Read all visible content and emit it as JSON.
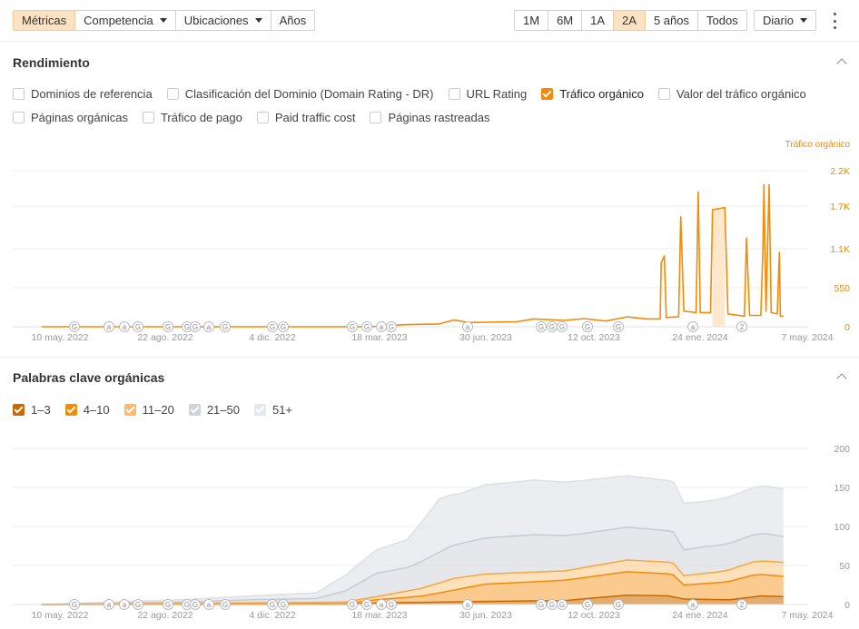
{
  "toolbar": {
    "left": [
      {
        "label": "Métricas",
        "active": true,
        "dropdown": false
      },
      {
        "label": "Competencia",
        "active": false,
        "dropdown": true
      },
      {
        "label": "Ubicaciones",
        "active": false,
        "dropdown": true
      },
      {
        "label": "Años",
        "active": false,
        "dropdown": false
      }
    ],
    "ranges": [
      {
        "label": "1M",
        "active": false
      },
      {
        "label": "6M",
        "active": false
      },
      {
        "label": "1A",
        "active": false
      },
      {
        "label": "2A",
        "active": true
      },
      {
        "label": "5 años",
        "active": false
      },
      {
        "label": "Todos",
        "active": false
      }
    ],
    "interval": "Diario"
  },
  "performance": {
    "title": "Rendimiento",
    "metrics_row1": [
      {
        "label": "Dominios de referencia",
        "checked": false
      },
      {
        "label": "Clasificación del Dominio (Domain Rating - DR)",
        "checked": false
      },
      {
        "label": "URL Rating",
        "checked": false
      },
      {
        "label": "Tráfico orgánico",
        "checked": true
      },
      {
        "label": "Valor del tráfico orgánico",
        "checked": false
      }
    ],
    "metrics_row2": [
      {
        "label": "Páginas orgánicas",
        "checked": false
      },
      {
        "label": "Tráfico de pago",
        "checked": false
      },
      {
        "label": "Paid traffic cost",
        "checked": false
      },
      {
        "label": "Páginas rastreadas",
        "checked": false
      }
    ]
  },
  "keywords": {
    "title": "Palabras clave orgánicas",
    "legend": [
      {
        "label": "1–3",
        "color": "#c96a00"
      },
      {
        "label": "4–10",
        "color": "#f58a07"
      },
      {
        "label": "11–20",
        "color": "#fbbb6a"
      },
      {
        "label": "21–50",
        "color": "#d0d4da"
      },
      {
        "label": "51+",
        "color": "#e4e7eb"
      }
    ]
  },
  "x_axis_ticks": [
    "10 may. 2022",
    "22 ago. 2022",
    "4 dic. 2022",
    "18 mar. 2023",
    "30 jun. 2023",
    "12 oct. 2023",
    "24 ene. 2024",
    "7 may. 2024"
  ],
  "markers": [
    "G",
    "a",
    "2"
  ],
  "colors": {
    "accent": "#f58a07",
    "accent_light": "#fde2c2",
    "grid": "#eeeeee"
  },
  "chart_data": [
    {
      "type": "line",
      "title": "",
      "series": [
        {
          "name": "Tráfico orgánico",
          "color": "#f58a07",
          "points": [
            [
              "2022-05-10",
              0
            ],
            [
              "2023-03-25",
              0
            ],
            [
              "2023-04-28",
              30
            ],
            [
              "2023-06-01",
              40
            ],
            [
              "2023-06-15",
              95
            ],
            [
              "2023-06-30",
              60
            ],
            [
              "2023-08-15",
              70
            ],
            [
              "2023-09-01",
              110
            ],
            [
              "2023-10-01",
              90
            ],
            [
              "2023-10-20",
              115
            ],
            [
              "2023-11-10",
              80
            ],
            [
              "2023-12-01",
              140
            ],
            [
              "2023-12-20",
              110
            ],
            [
              "2024-01-02",
              110
            ],
            [
              "2024-01-03",
              900
            ],
            [
              "2024-01-06",
              1000
            ],
            [
              "2024-01-08",
              130
            ],
            [
              "2024-01-20",
              140
            ],
            [
              "2024-01-22",
              1550
            ],
            [
              "2024-01-25",
              220
            ],
            [
              "2024-02-06",
              200
            ],
            [
              "2024-02-08",
              1900
            ],
            [
              "2024-02-10",
              200
            ],
            [
              "2024-02-20",
              200
            ],
            [
              "2024-02-22",
              1650
            ],
            [
              "2024-03-05",
              1680
            ],
            [
              "2024-03-08",
              180
            ],
            [
              "2024-03-24",
              150
            ],
            [
              "2024-03-26",
              1250
            ],
            [
              "2024-03-29",
              160
            ],
            [
              "2024-04-09",
              160
            ],
            [
              "2024-04-11",
              1100
            ],
            [
              "2024-04-12",
              2000
            ],
            [
              "2024-04-14",
              220
            ],
            [
              "2024-04-17",
              2000
            ],
            [
              "2024-04-19",
              200
            ],
            [
              "2024-04-25",
              180
            ],
            [
              "2024-04-27",
              1050
            ],
            [
              "2024-04-28",
              150
            ],
            [
              "2024-05-01",
              150
            ]
          ]
        }
      ],
      "ylabel": "Tráfico orgánico",
      "x_range": [
        "2022-04-12",
        "2024-05-25"
      ],
      "ylim": [
        0,
        2200
      ],
      "y_ticks": [
        0,
        550,
        1100,
        1700,
        2200
      ],
      "y_tick_labels": [
        "0",
        "550",
        "1.1K",
        "1.7K",
        "2.2K"
      ],
      "grid": true
    },
    {
      "type": "area",
      "title": "",
      "stacked": true,
      "x_range": [
        "2022-04-12",
        "2024-05-25"
      ],
      "ylim": [
        0,
        200
      ],
      "y_ticks": [
        0,
        50,
        100,
        150,
        200
      ],
      "grid": true,
      "series": [
        {
          "name": "1–3",
          "color": "#c96a00",
          "points": [
            [
              "2022-05-10",
              0
            ],
            [
              "2023-03-01",
              0
            ],
            [
              "2023-04-01",
              2
            ],
            [
              "2023-06-01",
              3
            ],
            [
              "2023-07-15",
              4
            ],
            [
              "2023-10-01",
              5
            ],
            [
              "2023-12-01",
              12
            ],
            [
              "2024-01-10",
              11
            ],
            [
              "2024-01-25",
              7
            ],
            [
              "2024-03-10",
              6
            ],
            [
              "2024-04-10",
              11
            ],
            [
              "2024-05-01",
              10
            ]
          ]
        },
        {
          "name": "4–10",
          "color": "#f58a07",
          "points": [
            [
              "2022-05-10",
              0
            ],
            [
              "2023-03-01",
              1
            ],
            [
              "2023-04-01",
              4
            ],
            [
              "2023-05-15",
              8
            ],
            [
              "2023-06-15",
              15
            ],
            [
              "2023-07-15",
              22
            ],
            [
              "2023-10-01",
              26
            ],
            [
              "2023-12-01",
              30
            ],
            [
              "2024-01-15",
              28
            ],
            [
              "2024-01-25",
              18
            ],
            [
              "2024-03-01",
              22
            ],
            [
              "2024-04-01",
              28
            ],
            [
              "2024-05-01",
              26
            ]
          ]
        },
        {
          "name": "11–20",
          "color": "#fbbb6a",
          "points": [
            [
              "2022-05-10",
              0
            ],
            [
              "2023-03-01",
              2
            ],
            [
              "2023-04-01",
              4
            ],
            [
              "2023-05-15",
              10
            ],
            [
              "2023-06-15",
              15
            ],
            [
              "2023-07-15",
              13
            ],
            [
              "2023-10-01",
              12
            ],
            [
              "2023-12-01",
              15
            ],
            [
              "2024-01-15",
              15
            ],
            [
              "2024-01-25",
              12
            ],
            [
              "2024-03-01",
              14
            ],
            [
              "2024-04-01",
              17
            ],
            [
              "2024-05-01",
              18
            ]
          ]
        },
        {
          "name": "21–50",
          "color": "#d0d4da",
          "points": [
            [
              "2022-05-10",
              0
            ],
            [
              "2022-10-01",
              2
            ],
            [
              "2022-12-01",
              4
            ],
            [
              "2023-02-01",
              5
            ],
            [
              "2023-03-01",
              14
            ],
            [
              "2023-04-01",
              30
            ],
            [
              "2023-05-01",
              30
            ],
            [
              "2023-05-20",
              36
            ],
            [
              "2023-06-10",
              42
            ],
            [
              "2023-07-15",
              46
            ],
            [
              "2023-09-01",
              48
            ],
            [
              "2023-10-15",
              44
            ],
            [
              "2023-12-01",
              42
            ],
            [
              "2024-01-15",
              40
            ],
            [
              "2024-01-25",
              33
            ],
            [
              "2024-02-15",
              34
            ],
            [
              "2024-03-15",
              34
            ],
            [
              "2024-04-15",
              35
            ],
            [
              "2024-05-01",
              33
            ]
          ]
        },
        {
          "name": "51+",
          "color": "#e4e7eb",
          "points": [
            [
              "2022-05-10",
              0
            ],
            [
              "2022-10-01",
              3
            ],
            [
              "2022-12-01",
              5
            ],
            [
              "2023-02-01",
              7
            ],
            [
              "2023-03-01",
              20
            ],
            [
              "2023-04-01",
              30
            ],
            [
              "2023-05-01",
              36
            ],
            [
              "2023-06-01",
              68
            ],
            [
              "2023-06-20",
              64
            ],
            [
              "2023-07-15",
              68
            ],
            [
              "2023-09-01",
              70
            ],
            [
              "2023-10-15",
              68
            ],
            [
              "2023-12-01",
              66
            ],
            [
              "2024-01-15",
              64
            ],
            [
              "2024-01-25",
              60
            ],
            [
              "2024-02-15",
              58
            ],
            [
              "2024-03-15",
              60
            ],
            [
              "2024-04-15",
              61
            ],
            [
              "2024-05-01",
              61
            ]
          ]
        }
      ]
    }
  ]
}
